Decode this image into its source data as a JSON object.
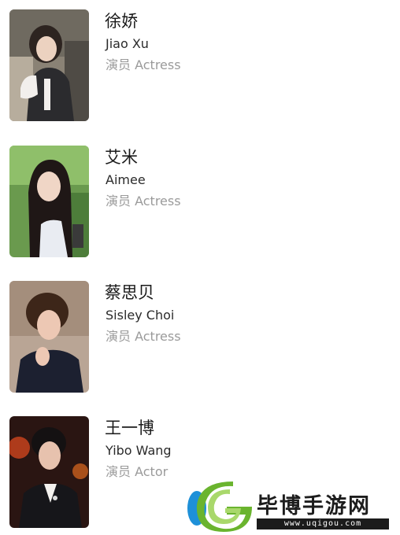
{
  "cast": [
    {
      "name_zh": "徐娇",
      "name_en": "Jiao Xu",
      "role": "演员 Actress"
    },
    {
      "name_zh": "艾米",
      "name_en": "Aimee",
      "role": "演员 Actress"
    },
    {
      "name_zh": "蔡思贝",
      "name_en": "Sisley Choi",
      "role": "演员 Actress"
    },
    {
      "name_zh": "王一博",
      "name_en": "Yibo Wang",
      "role": "演员 Actor"
    }
  ],
  "watermark": {
    "brand": "毕博手游网",
    "url": "www.uqigou.com"
  },
  "colors": {
    "name": "#1a1a1a",
    "role": "#9a9a9a",
    "watermark_green": "#6ab42e",
    "watermark_blue": "#1e90d8"
  }
}
